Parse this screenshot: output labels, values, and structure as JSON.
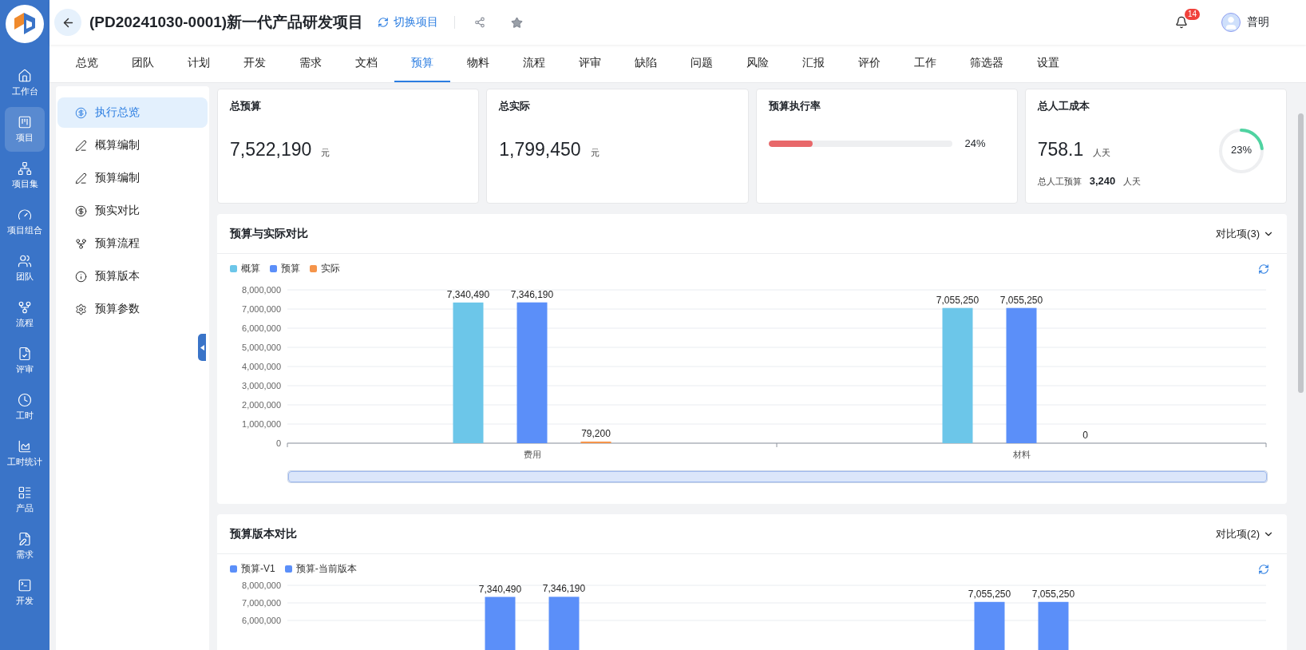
{
  "rail": {
    "items": [
      {
        "label": "工作台",
        "selected": false
      },
      {
        "label": "项目",
        "selected": true
      },
      {
        "label": "项目集",
        "selected": false
      },
      {
        "label": "项目组合",
        "selected": false
      },
      {
        "label": "团队",
        "selected": false
      },
      {
        "label": "流程",
        "selected": false
      },
      {
        "label": "评审",
        "selected": false
      },
      {
        "label": "工时",
        "selected": false
      },
      {
        "label": "工时统计",
        "selected": false
      },
      {
        "label": "产品",
        "selected": false
      },
      {
        "label": "需求",
        "selected": false
      },
      {
        "label": "开发",
        "selected": false
      }
    ]
  },
  "header": {
    "title": "(PD20241030-0001)新一代产品研发项目",
    "switch_link": "切换项目",
    "notification_count": "14",
    "user_name": "普明"
  },
  "tabs": [
    {
      "label": "总览",
      "selected": false
    },
    {
      "label": "团队",
      "selected": false
    },
    {
      "label": "计划",
      "selected": false
    },
    {
      "label": "开发",
      "selected": false
    },
    {
      "label": "需求",
      "selected": false
    },
    {
      "label": "文档",
      "selected": false
    },
    {
      "label": "预算",
      "selected": true
    },
    {
      "label": "物料",
      "selected": false
    },
    {
      "label": "流程",
      "selected": false
    },
    {
      "label": "评审",
      "selected": false
    },
    {
      "label": "缺陷",
      "selected": false
    },
    {
      "label": "问题",
      "selected": false
    },
    {
      "label": "风险",
      "selected": false
    },
    {
      "label": "汇报",
      "selected": false
    },
    {
      "label": "评价",
      "selected": false
    },
    {
      "label": "工作",
      "selected": false
    },
    {
      "label": "筛选器",
      "selected": false
    },
    {
      "label": "设置",
      "selected": false
    }
  ],
  "submenu": [
    {
      "label": "执行总览",
      "selected": true
    },
    {
      "label": "概算编制",
      "selected": false
    },
    {
      "label": "预算编制",
      "selected": false
    },
    {
      "label": "预实对比",
      "selected": false
    },
    {
      "label": "预算流程",
      "selected": false
    },
    {
      "label": "预算版本",
      "selected": false
    },
    {
      "label": "预算参数",
      "selected": false
    }
  ],
  "kpis": [
    {
      "kind": "amount",
      "title": "总预算",
      "value": "7,522,190",
      "unit": "元"
    },
    {
      "kind": "amount",
      "title": "总实际",
      "value": "1,799,450",
      "unit": "元"
    },
    {
      "kind": "progress",
      "title": "预算执行率",
      "level": 0.24,
      "reading": "24%"
    },
    {
      "kind": "ring",
      "title": "总人工成本",
      "value": "758.1",
      "unit": "人天",
      "sub_label": "总人工预算",
      "sub_value": "3,240",
      "sub_unit": "人天",
      "level": 0.23,
      "reading": "23%"
    }
  ],
  "charts": [
    {
      "title": "预算与实际对比",
      "compare_label": "对比项(3)",
      "range_slider": {
        "level": 1
      },
      "chart_data": {
        "type": "bar",
        "grid": true,
        "stacked": false,
        "categories": [
          "费用",
          "材料"
        ],
        "series": [
          {
            "name": "概算",
            "color": "#6cc6e9",
            "values": [
              7340490,
              7055250
            ]
          },
          {
            "name": "预算",
            "color": "#5b8ff9",
            "values": [
              7346190,
              7055250
            ]
          },
          {
            "name": "实际",
            "color": "#f5944a",
            "values": [
              79200,
              0
            ]
          }
        ],
        "ylim": [
          0,
          8000000
        ],
        "yticks": [
          {
            "value": 0,
            "label": "0"
          },
          {
            "value": 1000000,
            "label": "1,000,000"
          },
          {
            "value": 2000000,
            "label": "2,000,000"
          },
          {
            "value": 3000000,
            "label": "3,000,000"
          },
          {
            "value": 4000000,
            "label": "4,000,000"
          },
          {
            "value": 5000000,
            "label": "5,000,000"
          },
          {
            "value": 6000000,
            "label": "6,000,000"
          },
          {
            "value": 7000000,
            "label": "7,000,000"
          },
          {
            "value": 8000000,
            "label": "8,000,000"
          }
        ],
        "value_labels": [
          [
            "7,340,490",
            "7,055,250"
          ],
          [
            "7,346,190",
            "7,055,250"
          ],
          [
            "79,200",
            "0"
          ]
        ]
      }
    },
    {
      "title": "预算版本对比",
      "compare_label": "对比项(2)",
      "chart_data": {
        "type": "bar",
        "grid": true,
        "stacked": false,
        "series": [
          {
            "name": "预算-V1",
            "color": "#5b8ff9",
            "values": [
              7340490,
              7055250
            ]
          },
          {
            "name": "预算-当前版本",
            "color": "#5b8ff9",
            "values": [
              7346190,
              7055250
            ]
          }
        ],
        "ylim": [
          0,
          8000000
        ],
        "yticks": [
          {
            "value": 6000000,
            "label": "6,000,000"
          },
          {
            "value": 7000000,
            "label": "7,000,000"
          },
          {
            "value": 8000000,
            "label": "8,000,000"
          }
        ],
        "value_labels": [
          [
            "7,340,490",
            "7,055,250"
          ],
          [
            "7,346,190",
            "7,055,250"
          ]
        ]
      }
    }
  ]
}
